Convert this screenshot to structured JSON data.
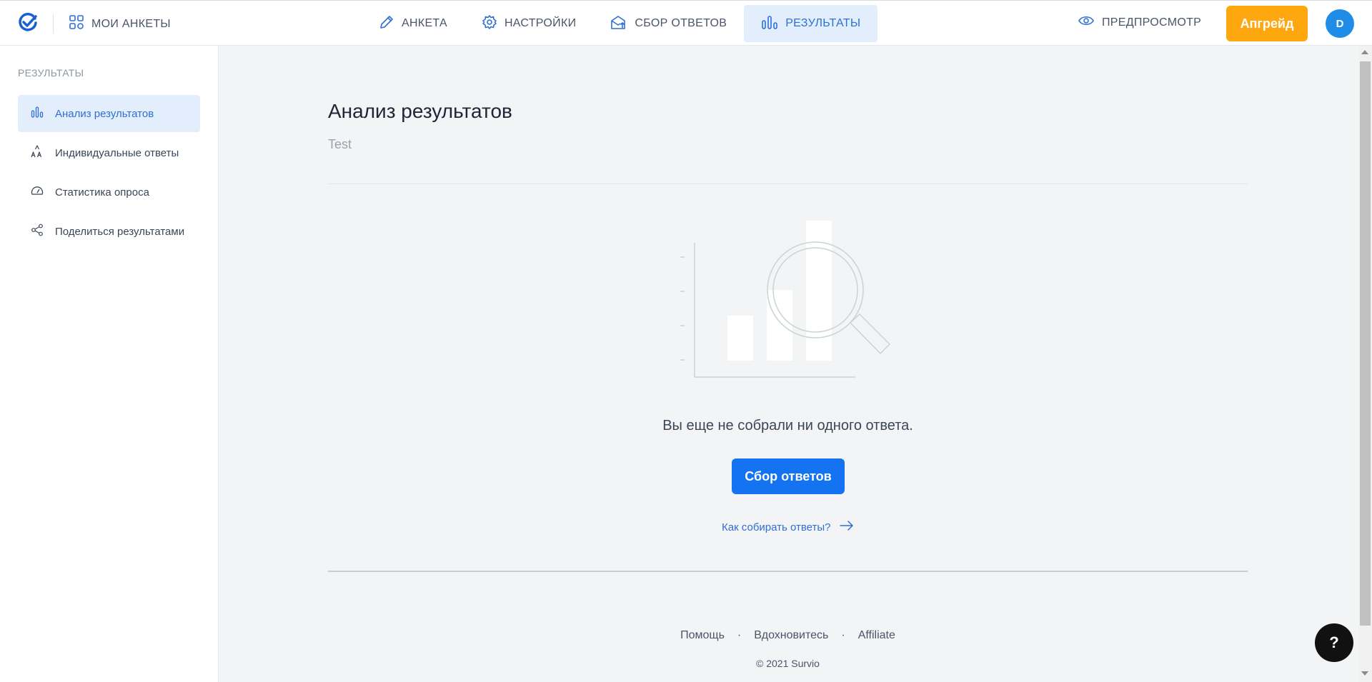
{
  "header": {
    "my_surveys_label": "МОИ АНКЕТЫ",
    "nav": [
      {
        "label": "АНКЕТА",
        "icon": "pencil-icon"
      },
      {
        "label": "НАСТРОЙКИ",
        "icon": "gear-icon"
      },
      {
        "label": "СБОР ОТВЕТОВ",
        "icon": "envelope-upload-icon"
      },
      {
        "label": "РЕЗУЛЬТАТЫ",
        "icon": "bar-chart-icon",
        "active": true
      }
    ],
    "preview_label": "ПРЕДПРОСМОТР",
    "upgrade_label": "Апгрейд",
    "avatar_initial": "D"
  },
  "sidebar": {
    "title": "РЕЗУЛЬТАТЫ",
    "items": [
      {
        "label": "Анализ результатов",
        "icon": "bar-chart-icon",
        "active": true
      },
      {
        "label": "Индивидуальные ответы",
        "icon": "text-aa-icon"
      },
      {
        "label": "Статистика опроса",
        "icon": "gauge-icon"
      },
      {
        "label": "Поделиться результатами",
        "icon": "share-icon"
      }
    ]
  },
  "main": {
    "title": "Анализ результатов",
    "subtitle": "Test",
    "empty_message": "Вы еще не собрали ни одного ответа.",
    "collect_button": "Сбор ответов",
    "how_link": "Как собирать ответы?"
  },
  "footer": {
    "links": [
      "Помощь",
      "Вдохновитесь",
      "Affiliate"
    ],
    "separator": "·",
    "copyright": "© 2021 Survio"
  },
  "help_button": "?",
  "colors": {
    "accent": "#2d6fd6",
    "primary_button": "#1373f0",
    "upgrade": "#ffa70f",
    "avatar": "#1f8ce8",
    "active_bg": "#e3eefc"
  }
}
